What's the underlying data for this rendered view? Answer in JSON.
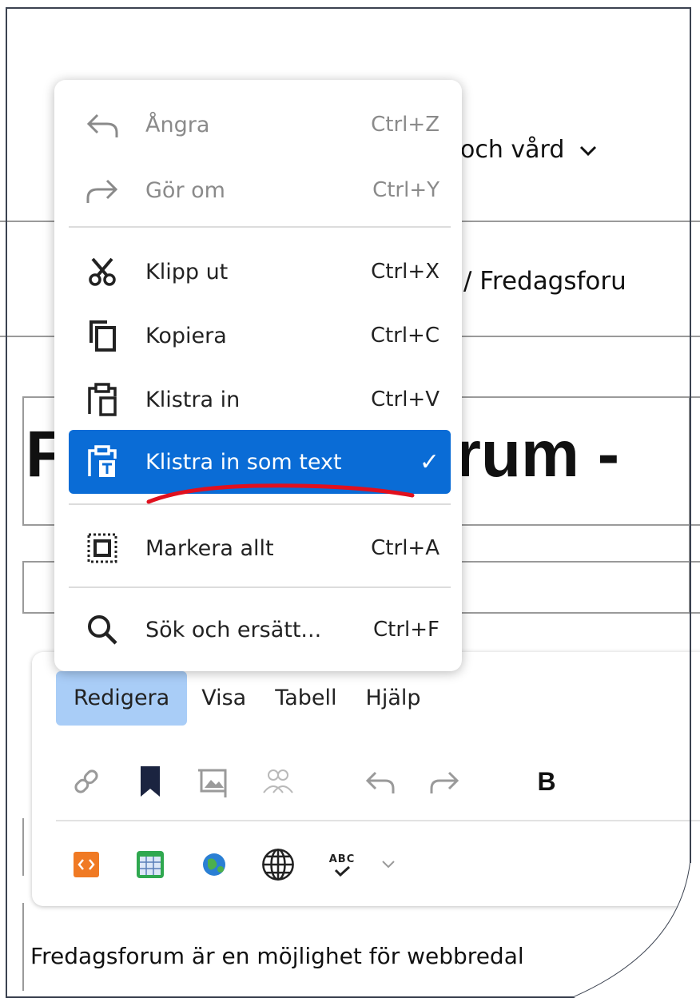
{
  "background": {
    "nav_text": "och vård",
    "breadcrumb_text": "/ Fredagsforu",
    "page_title_text": "rum -",
    "title_first_letter": "F",
    "body_text": "Fredagsforum är en möjlighet för webbredal"
  },
  "editor": {
    "menubar": [
      "Redigera",
      "Visa",
      "Tabell",
      "Hjälp"
    ],
    "bold_label": "B",
    "spellcheck_label": "ABC"
  },
  "context_menu": {
    "items": [
      {
        "label": "Ångra",
        "shortcut": "Ctrl+Z",
        "icon": "undo-icon",
        "disabled": true
      },
      {
        "label": "Gör om",
        "shortcut": "Ctrl+Y",
        "icon": "redo-icon",
        "disabled": true
      },
      {
        "label": "Klipp ut",
        "shortcut": "Ctrl+X",
        "icon": "scissors-icon",
        "disabled": false
      },
      {
        "label": "Kopiera",
        "shortcut": "Ctrl+C",
        "icon": "copy-icon",
        "disabled": false
      },
      {
        "label": "Klistra in",
        "shortcut": "Ctrl+V",
        "icon": "paste-icon",
        "disabled": false
      },
      {
        "label": "Klistra in som text",
        "shortcut": "✓",
        "icon": "paste-text-icon",
        "selected": true
      },
      {
        "label": "Markera allt",
        "shortcut": "Ctrl+A",
        "icon": "select-all-icon",
        "disabled": false
      },
      {
        "label": "Sök och ersätt...",
        "shortcut": "Ctrl+F",
        "icon": "search-icon",
        "disabled": false
      }
    ]
  },
  "colors": {
    "selected_bg": "#0a6cd6",
    "menubar_active_bg": "#a9cdf7",
    "annotation": "#e0101e"
  }
}
